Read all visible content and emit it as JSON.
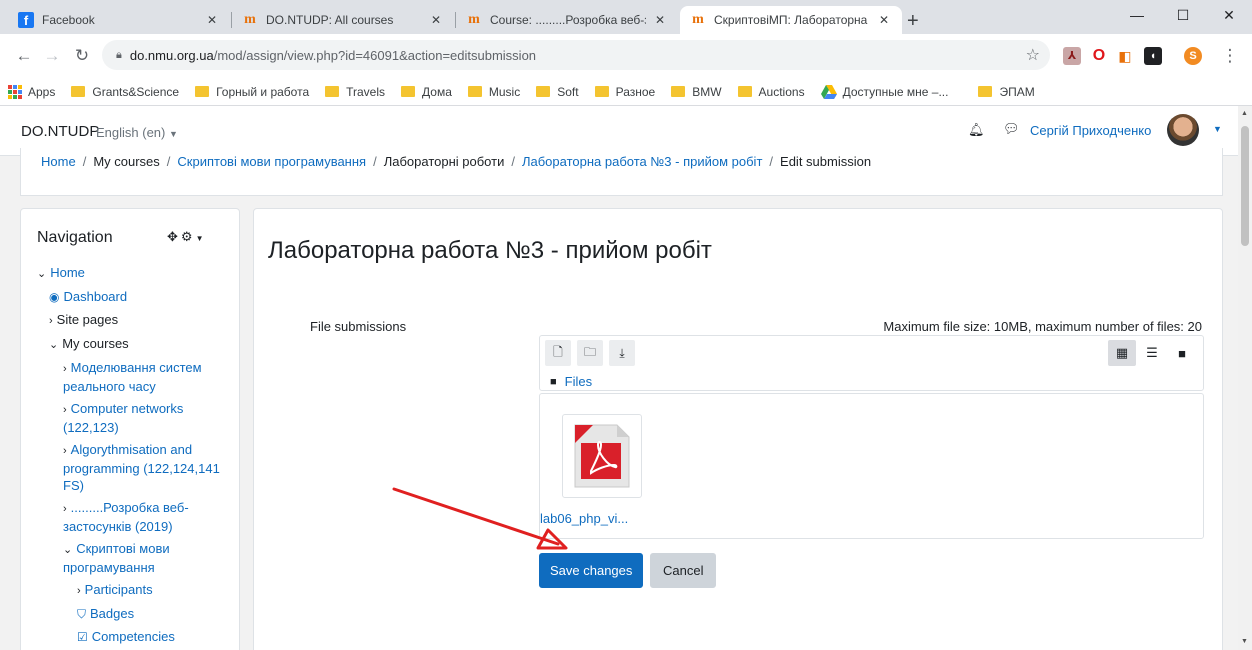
{
  "browser": {
    "tabs": [
      {
        "title": "Facebook",
        "icon": "facebook-icon"
      },
      {
        "title": "DO.NTUDP: All courses",
        "icon": "moodle-icon"
      },
      {
        "title": "Course: .........Розробка веб-застос",
        "icon": "moodle-icon"
      },
      {
        "title": "СкриптовіМП: Лабораторна раб",
        "icon": "moodle-icon"
      }
    ],
    "url_host": "do.nmu.org.ua",
    "url_path": "/mod/assign/view.php?id=46091&action=editsubmission",
    "bookmarks": [
      {
        "label": "Apps",
        "icon": "apps-icon"
      },
      {
        "label": "Grants&Science",
        "icon": "folder-icon"
      },
      {
        "label": "Горный и работа",
        "icon": "folder-icon"
      },
      {
        "label": "Travels",
        "icon": "folder-icon"
      },
      {
        "label": "Дома",
        "icon": "folder-icon"
      },
      {
        "label": "Music",
        "icon": "folder-icon"
      },
      {
        "label": "Soft",
        "icon": "folder-icon"
      },
      {
        "label": "Разное",
        "icon": "folder-icon"
      },
      {
        "label": "BMW",
        "icon": "folder-icon"
      },
      {
        "label": "Auctions",
        "icon": "folder-icon"
      },
      {
        "label": "Доступные мне –...",
        "icon": "google-drive-icon"
      },
      {
        "label": "ЭПАМ",
        "icon": "folder-icon"
      }
    ],
    "extensions": [
      "pdf-extension-icon",
      "opera-icon",
      "extension-icon",
      "extension-icon",
      "profile-icon"
    ],
    "profile_initial": "S"
  },
  "moodle": {
    "brand": "DO.NTUDP",
    "language": "English (en)",
    "user_name": "Сергій Приходченко",
    "breadcrumb": [
      {
        "label": "Home",
        "link": true
      },
      {
        "label": "My courses",
        "link": false
      },
      {
        "label": "Скриптові мови програмування",
        "link": true
      },
      {
        "label": "Лабораторні роботи",
        "link": false
      },
      {
        "label": "Лабораторна работа №3 - прийом робіт",
        "link": true
      },
      {
        "label": "Edit submission",
        "link": false
      }
    ],
    "navigation": {
      "title": "Navigation",
      "items": [
        {
          "label": "Home",
          "toggle": "v",
          "level": 0,
          "link": true
        },
        {
          "label": "Dashboard",
          "icon": "dashboard-icon",
          "level": 1,
          "link": true
        },
        {
          "label": "Site pages",
          "toggle": ">",
          "level": 1,
          "link": false
        },
        {
          "label": "My courses",
          "toggle": "v",
          "level": 1,
          "link": false
        },
        {
          "label": "Моделювання систем реального часу",
          "toggle": ">",
          "level": 2,
          "link": true
        },
        {
          "label": "Computer networks (122,123)",
          "toggle": ">",
          "level": 2,
          "link": true
        },
        {
          "label": "Algorythmisation and programming (122,124,141 FS)",
          "toggle": ">",
          "level": 2,
          "link": true
        },
        {
          "label": ".........Розробка веб-застосунків (2019)",
          "toggle": ">",
          "level": 2,
          "link": true
        },
        {
          "label": "Скриптові мови програмування",
          "toggle": "v",
          "level": 2,
          "link": true
        },
        {
          "label": "Participants",
          "toggle": ">",
          "level": 3,
          "link": true
        },
        {
          "label": "Badges",
          "icon": "shield-icon",
          "level": 3,
          "link": true
        },
        {
          "label": "Competencies",
          "icon": "checkbox-icon",
          "level": 3,
          "link": true
        }
      ]
    },
    "main": {
      "title": "Лабораторна работа №3 - прийом робіт",
      "file_submissions_label": "File submissions",
      "file_limit": "Maximum file size: 10MB, maximum number of files: 20",
      "path_label": "Files",
      "files": [
        {
          "name": "lab06_php_vi...",
          "icon": "pdf-file-icon"
        }
      ],
      "save_label": "Save changes",
      "cancel_label": "Cancel"
    }
  },
  "colors": {
    "link": "#0f6cbf",
    "primary_button": "#0f6cbf",
    "arrow": "#e02020",
    "pdf_red": "#d9202a"
  }
}
